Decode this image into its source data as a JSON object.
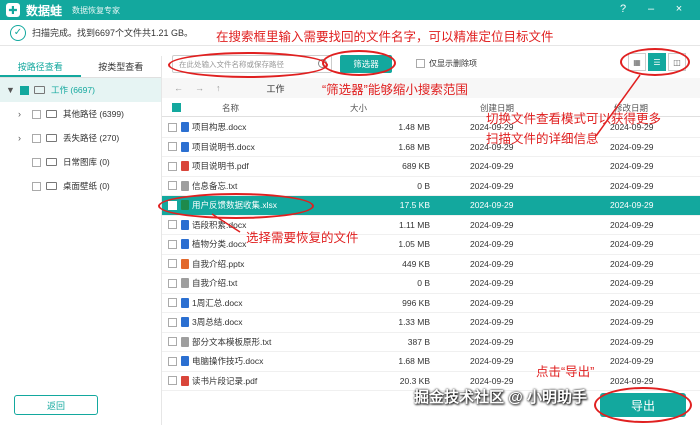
{
  "app": {
    "brand": "数据蛙",
    "subtitle": "数据恢复专家",
    "logo_glyph": "✚"
  },
  "window_controls": {
    "help": "?",
    "minimize": "–",
    "close": "×"
  },
  "status": {
    "text": "扫描完成。找到6697个文件共1.21 GB。"
  },
  "annotations": {
    "search_tip": "在搜索框里输入需要找回的文件名字，可以精准定位目标文件",
    "filter_tip": "“筛选器”能够缩小搜索范围",
    "view_tip_line1": "切换文件查看模式可以获得更多",
    "view_tip_line2": "扫描文件的详细信息",
    "select_tip": "选择需要恢复的文件",
    "export_tip": "点击“导出”"
  },
  "sidebar": {
    "tabs": [
      {
        "label": "按路径查看",
        "active": true
      },
      {
        "label": "按类型查看",
        "active": false
      }
    ],
    "items": [
      {
        "label": "工作 (6697)",
        "selected": true,
        "checked": true,
        "arrow": "▼"
      },
      {
        "label": "其他路径 (6399)",
        "selected": false,
        "checked": false,
        "arrow": "›"
      },
      {
        "label": "丢失路径 (270)",
        "selected": false,
        "checked": false,
        "arrow": "›"
      },
      {
        "label": "日常图库 (0)",
        "selected": false,
        "checked": false,
        "arrow": ""
      },
      {
        "label": "桌面壁纸 (0)",
        "selected": false,
        "checked": false,
        "arrow": ""
      }
    ],
    "back_label": "返回"
  },
  "toolbar": {
    "search_placeholder": "在此处输入文件名称或保存路径",
    "filter_label": "筛选器",
    "deleted_only_label": "仅显示删除项"
  },
  "nav": {
    "back": "←",
    "forward": "→",
    "up": "↑",
    "path": "工作"
  },
  "table": {
    "headers": {
      "name": "名称",
      "size": "大小",
      "created": "创建日期",
      "modified": "修改日期"
    },
    "rows": [
      {
        "name": "项目构思.docx",
        "size": "1.48 MB",
        "created": "2024-09-29",
        "modified": "2024-09-29",
        "type": "docx",
        "selected": false
      },
      {
        "name": "项目说明书.docx",
        "size": "1.68 MB",
        "created": "2024-09-29",
        "modified": "2024-09-29",
        "type": "docx",
        "selected": false
      },
      {
        "name": "项目说明书.pdf",
        "size": "689 KB",
        "created": "2024-09-29",
        "modified": "2024-09-29",
        "type": "pdf",
        "selected": false
      },
      {
        "name": "信息备忘.txt",
        "size": "0 B",
        "created": "2024-09-29",
        "modified": "2024-09-29",
        "type": "txt",
        "selected": false
      },
      {
        "name": "用户反馈数据收集.xlsx",
        "size": "17.5 KB",
        "created": "2024-09-29",
        "modified": "2024-09-29",
        "type": "xlsx",
        "selected": true
      },
      {
        "name": "语段积累.docx",
        "size": "1.11 MB",
        "created": "2024-09-29",
        "modified": "2024-09-29",
        "type": "docx",
        "selected": false
      },
      {
        "name": "植物分类.docx",
        "size": "1.05 MB",
        "created": "2024-09-29",
        "modified": "2024-09-29",
        "type": "docx",
        "selected": false
      },
      {
        "name": "自我介绍.pptx",
        "size": "449 KB",
        "created": "2024-09-29",
        "modified": "2024-09-29",
        "type": "pptx",
        "selected": false
      },
      {
        "name": "自我介绍.txt",
        "size": "0 B",
        "created": "2024-09-29",
        "modified": "2024-09-29",
        "type": "txt",
        "selected": false
      },
      {
        "name": "1周汇总.docx",
        "size": "996 KB",
        "created": "2024-09-29",
        "modified": "2024-09-29",
        "type": "docx",
        "selected": false
      },
      {
        "name": "3周总结.docx",
        "size": "1.33 MB",
        "created": "2024-09-29",
        "modified": "2024-09-29",
        "type": "docx",
        "selected": false
      },
      {
        "name": "部分文本模板原形.txt",
        "size": "387 B",
        "created": "2024-09-29",
        "modified": "2024-09-29",
        "type": "txt",
        "selected": false
      },
      {
        "name": "电脑操作技巧.docx",
        "size": "1.68 MB",
        "created": "2024-09-29",
        "modified": "2024-09-29",
        "type": "docx",
        "selected": false
      },
      {
        "name": "读书片段记录.pdf",
        "size": "20.3 KB",
        "created": "2024-09-29",
        "modified": "2024-09-29",
        "type": "pdf",
        "selected": false
      }
    ]
  },
  "export_label": "导出",
  "watermark": "掘金技术社区 @ 小明助手",
  "colors": {
    "accent": "#13a89e",
    "annotation": "#e02020",
    "docx": "#2b6fd1",
    "pdf": "#d9453a",
    "xlsx": "#1e8a4c",
    "pptx": "#e2692c",
    "txt": "#9e9e9e"
  }
}
